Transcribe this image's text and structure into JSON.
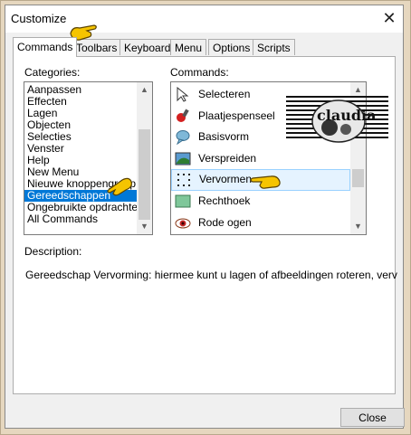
{
  "dialog": {
    "title": "Customize",
    "close_label": "Close"
  },
  "tabs": [
    {
      "label": "Commands",
      "active": true
    },
    {
      "label": "Toolbars",
      "active": false
    },
    {
      "label": "Keyboard",
      "active": false
    },
    {
      "label": "Menu",
      "active": false
    },
    {
      "label": "Options",
      "active": false
    },
    {
      "label": "Scripts",
      "active": false
    }
  ],
  "categories": {
    "label": "Categories:",
    "items": [
      "Aanpassen",
      "Effecten",
      "Lagen",
      "Objecten",
      "Selecties",
      "Venster",
      "Help",
      "New Menu",
      "Nieuwe knoppengroep",
      "Gereedschappen",
      "Ongebruikte opdrachten",
      "All Commands"
    ],
    "selected": "Gereedschappen"
  },
  "commands": {
    "label": "Commands:",
    "items": [
      {
        "label": "Selecteren",
        "icon": "arrow-pointer-icon"
      },
      {
        "label": "Plaatjespenseel",
        "icon": "picture-tube-icon"
      },
      {
        "label": "Basisvorm",
        "icon": "speech-bubble-icon"
      },
      {
        "label": "Verspreiden",
        "icon": "warp-brush-icon"
      },
      {
        "label": "Vervormen",
        "icon": "pick-tool-icon"
      },
      {
        "label": "Rechthoek",
        "icon": "rectangle-icon"
      },
      {
        "label": "Rode ogen",
        "icon": "red-eye-icon"
      }
    ],
    "highlighted": "Vervormen"
  },
  "description": {
    "label": "Description:",
    "text": "Gereedschap Vervorming: hiermee kunt u lagen of afbeeldingen roteren, verv"
  },
  "watermark": {
    "text": "claudia"
  },
  "colors": {
    "selection": "#0078d7",
    "hover": "#e5f3ff",
    "pointer_hand": "#f5c400"
  }
}
